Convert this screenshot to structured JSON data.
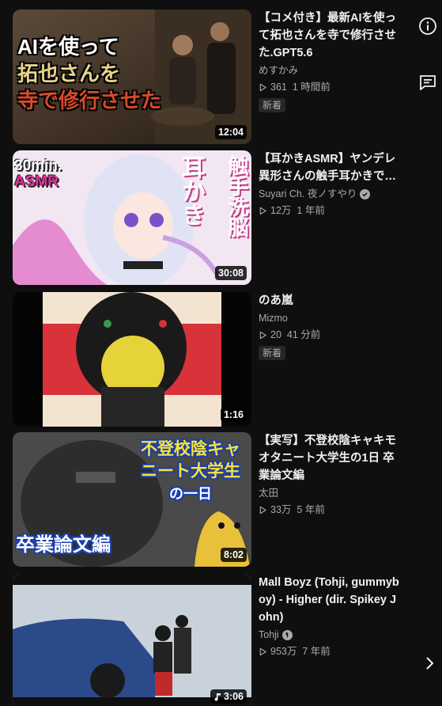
{
  "videos": [
    {
      "title": "【コメ付き】最新AIを使って拓也さんを寺で修行させた.GPT5.6",
      "channel": "めすかみ",
      "views": "361",
      "age": "1 時間前",
      "badge": "新着",
      "duration": "12:04",
      "thumb_text": [
        "AIを使って",
        "拓也さんを",
        "寺で修行させた"
      ]
    },
    {
      "title": "【耳かきASMR】ヤンデレ異形さんの触手耳かきで洗脳されて、幸せな…",
      "channel": "Suyari Ch. 夜ノすやり",
      "views": "12万",
      "age": "1 年前",
      "duration": "30:08",
      "thumb_text": [
        "30min.",
        "ASMR",
        "触手洗脳",
        "耳かき"
      ]
    },
    {
      "title": "のあ嵐",
      "channel": "Mizmo",
      "views": "20",
      "age": "41 分前",
      "badge": "新着",
      "duration": "1:16"
    },
    {
      "title": "【実写】不登校陰キャキモオタニート大学生の1日 卒業論文編",
      "channel": "太田",
      "views": "33万",
      "age": "5 年前",
      "duration": "8:02",
      "thumb_text": [
        "不登校陰キャ",
        "ニート大学生",
        "の一日",
        "卒業論文編"
      ]
    },
    {
      "title": "Mall Boyz (Tohji, gummyboy) - Higher (dir. Spikey John)",
      "channel": "Tohji",
      "views": "953万",
      "age": "7 年前",
      "duration": "3:06"
    }
  ],
  "side_icons": [
    "info-icon",
    "feedback-icon",
    "next-arrow-icon"
  ]
}
